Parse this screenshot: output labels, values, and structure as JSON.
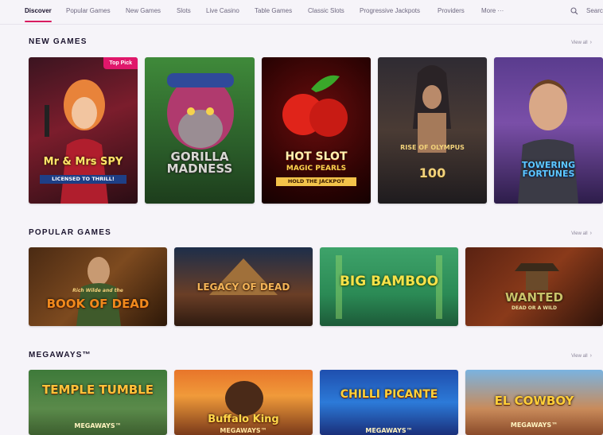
{
  "nav": {
    "items": [
      {
        "label": "Discover"
      },
      {
        "label": "Popular Games"
      },
      {
        "label": "New Games"
      },
      {
        "label": "Slots"
      },
      {
        "label": "Live Casino"
      },
      {
        "label": "Table Games"
      },
      {
        "label": "Classic Slots"
      },
      {
        "label": "Progressive Jackpots"
      },
      {
        "label": "Providers"
      },
      {
        "label": "More"
      }
    ],
    "more_dots": "···",
    "search_label": "Search",
    "accent": "#d81b60"
  },
  "sections": {
    "new_games": {
      "title": "NEW GAMES",
      "view_all": "View all",
      "games": [
        {
          "title": "Mr & Mrs SPY",
          "subtitle": "LICENSED TO THRILL!",
          "badge": "Top Pick"
        },
        {
          "title": "GORILLA MADNESS",
          "subtitle": ""
        },
        {
          "title": "HOT SLOT",
          "subtitle": "MAGIC PEARLS",
          "extra": "HOLD THE JACKPOT"
        },
        {
          "title": "RISE OF OLYMPUS",
          "subtitle": "100"
        },
        {
          "title": "TOWERING FORTUNES",
          "subtitle": ""
        }
      ]
    },
    "popular_games": {
      "title": "POPULAR GAMES",
      "view_all": "View all",
      "games": [
        {
          "title": "BOOK OF DEAD",
          "subtitle": "Rich Wilde and the"
        },
        {
          "title": "LEGACY OF DEAD",
          "subtitle": ""
        },
        {
          "title": "BIG BAMBOO",
          "subtitle": ""
        },
        {
          "title": "WANTED",
          "subtitle": "DEAD OR A WILD"
        }
      ]
    },
    "megaways": {
      "title": "MEGAWAYS™",
      "view_all": "View all",
      "games": [
        {
          "title": "TEMPLE TUMBLE",
          "subtitle": "MEGAWAYS™"
        },
        {
          "title": "Buffalo King",
          "subtitle": "MEGAWAYS™"
        },
        {
          "title": "CHILLI PICANTE",
          "subtitle": "MEGAWAYS™"
        },
        {
          "title": "EL COWBOY",
          "subtitle": "MEGAWAYS™"
        }
      ]
    }
  }
}
